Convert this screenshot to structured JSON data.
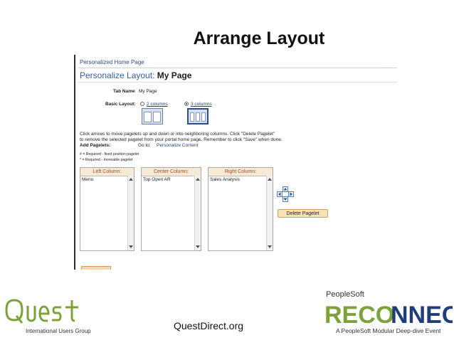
{
  "slide": {
    "title": "Arrange Layout",
    "site": "QuestDirect.org"
  },
  "screenshot": {
    "breadcrumb": "Personalized Home Page",
    "heading_prefix": "Personalize Layout:",
    "heading_page": "My Page",
    "tab_name_label": "Tab Name",
    "tab_name_value": "My Page",
    "basic_layout_label": "Basic Layout:",
    "option_two": "2 columns",
    "option_three": "3 columns",
    "instructions_1": "Click arrows to move pagelets up and down or into neighboring columns. Click \"Delete Pagelet\"",
    "instructions_2": "to remove the selected pagelet from your portal home page. Remember to click \"Save\" when done.",
    "add_pagelets_label": "Add Pagelets:",
    "goto_label": "Go to:",
    "goto_link": "Personalize Content",
    "legend_fixed": "# = Required - fixed position pagelet",
    "legend_moveable": "* = Required - moveable pagelet",
    "columns": [
      {
        "header": "Left Column:",
        "items": [
          "Menu"
        ]
      },
      {
        "header": "Center Column:",
        "items": [
          "Top Open AR"
        ]
      },
      {
        "header": "Right Column:",
        "items": [
          "Sales Analysis"
        ]
      }
    ],
    "delete_button": "Delete Pagelet"
  },
  "branding": {
    "quest_name": "Quest",
    "quest_sub": "International Users Group",
    "ps_label": "PeopleSoft",
    "reconnect_re": "RECO",
    "reconnect_nnect": "NNECT",
    "reconnect_sub": "A PeopleSoft Modular Deep-dive Event",
    "green": "#7da23a",
    "navy": "#1f3e78"
  }
}
